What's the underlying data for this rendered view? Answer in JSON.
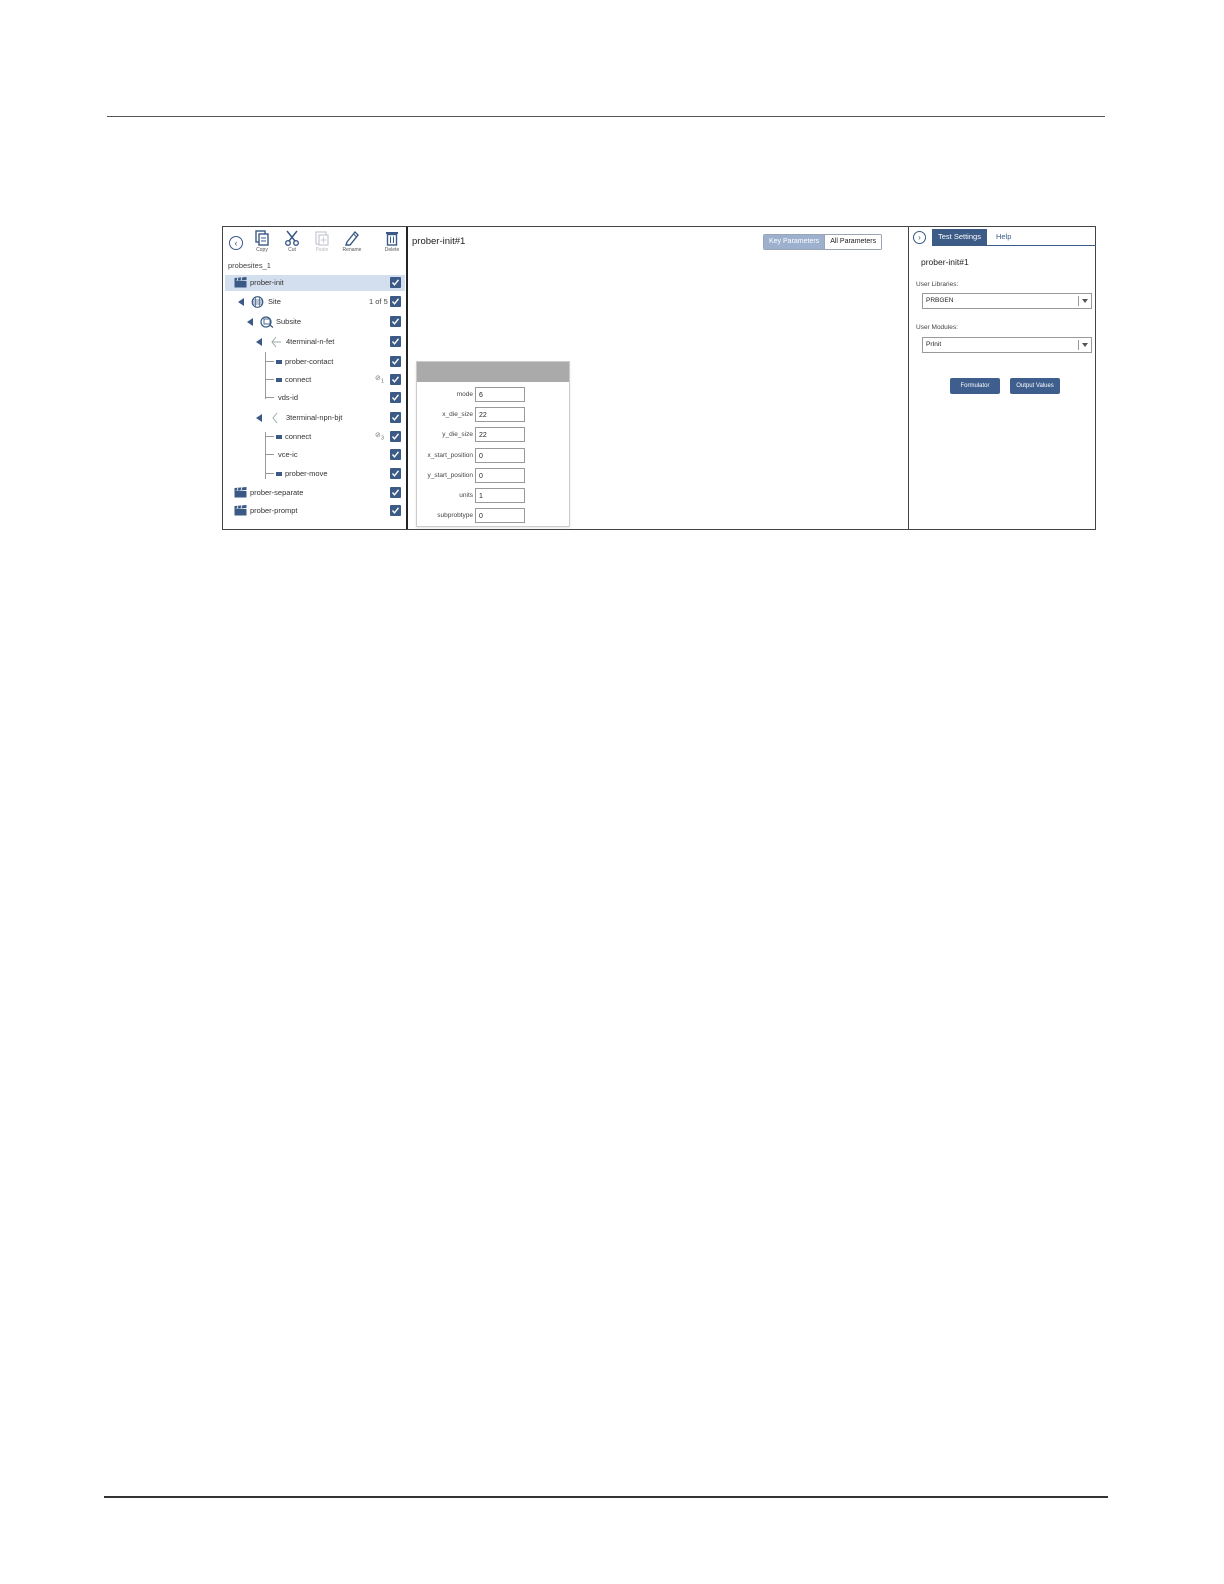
{
  "toolbar": {
    "copy_label": "Copy",
    "cut_label": "Cut",
    "paste_label": "Paste",
    "rename_label": "Rename",
    "delete_label": "Delete"
  },
  "project": {
    "name": "probesites_1"
  },
  "tree": {
    "prober_init": "prober-init",
    "site": "Site",
    "site_count": "1 of 5",
    "subsite": "Subsite",
    "device1": "4terminal-n-fet",
    "prober_contact": "prober-contact",
    "connect1": "connect",
    "connect1_badge": "1",
    "vds_id": "vds-id",
    "device2": "3terminal-npn-bjt",
    "connect2": "connect",
    "connect2_badge": "3",
    "vce_ic": "vce-ic",
    "prober_move": "prober-move",
    "prober_separate": "prober-separate",
    "prober_prompt": "prober-prompt"
  },
  "main": {
    "title": "prober-init#1",
    "view_toggle": {
      "key": "Key Parameters",
      "all": "All Parameters"
    },
    "parameters": [
      {
        "name": "mode",
        "value": "6"
      },
      {
        "name": "x_die_size",
        "value": "22"
      },
      {
        "name": "y_die_size",
        "value": "22"
      },
      {
        "name": "x_start_position",
        "value": "0"
      },
      {
        "name": "y_start_position",
        "value": "0"
      },
      {
        "name": "units",
        "value": "1"
      },
      {
        "name": "subprobtype",
        "value": "0"
      }
    ]
  },
  "right": {
    "tab_settings": "Test Settings",
    "tab_help": "Help",
    "title": "prober-init#1",
    "libraries_label": "User Libraries:",
    "libraries_value": "PRBGEN",
    "modules_label": "User Modules:",
    "modules_value": "PrInit",
    "formulator_label": "Formulator",
    "output_label": "Output Values"
  },
  "colors": {
    "accent": "#3c5b86",
    "selected_row": "#d3deee",
    "param_header": "#aaaaaa"
  }
}
